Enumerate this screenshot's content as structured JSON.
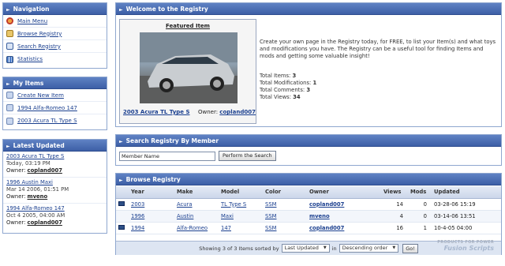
{
  "navigation": {
    "title": "Navigation",
    "items": [
      {
        "label": "Main Menu",
        "icon": "home-icon"
      },
      {
        "label": "Browse Registry",
        "icon": "browse-icon"
      },
      {
        "label": "Search Registry",
        "icon": "search-icon"
      },
      {
        "label": "Statistics",
        "icon": "statistics-icon"
      }
    ]
  },
  "my_items": {
    "title": "My Items",
    "items": [
      {
        "label": "Create New Item"
      },
      {
        "label": "1994 Alfa-Romeo 147"
      },
      {
        "label": "2003 Acura TL Type S"
      }
    ]
  },
  "latest_updated": {
    "title": "Latest Updated",
    "entries": [
      {
        "title": "2003 Acura TL Type S",
        "date": "Today, 03:19 PM",
        "owner_label": "Owner:",
        "owner": "copland007"
      },
      {
        "title": "1996 Austin Maxi",
        "date": "Mar 14 2006, 01:51 PM",
        "owner_label": "Owner:",
        "owner": "mveno"
      },
      {
        "title": "1994 Alfa-Romeo 147",
        "date": "Oct 4 2005, 04:00 AM",
        "owner_label": "Owner:",
        "owner": "copland007"
      }
    ]
  },
  "welcome": {
    "title": "Welcome to the Registry",
    "featured_title": "Featured Item",
    "featured_caption": "2003 Acura TL Type S",
    "featured_owner_label": "Owner:",
    "featured_owner": "copland007",
    "intro": "Create your own page in the Registry today, for FREE, to list your Item(s) and what toys and modifications you have. The Registry can be a useful tool for finding Items and mods and getting some valuable insight!",
    "stats": [
      {
        "label": "Total Items:",
        "value": "3"
      },
      {
        "label": "Total Modifications:",
        "value": "1"
      },
      {
        "label": "Total Comments:",
        "value": "3"
      },
      {
        "label": "Total Views:",
        "value": "34"
      }
    ]
  },
  "search": {
    "title": "Search Registry By Member",
    "input_value": "Member Name",
    "button": "Perform the Search"
  },
  "browse": {
    "title": "Browse Registry",
    "columns": [
      "Year",
      "Make",
      "Model",
      "Color",
      "Owner",
      "Views",
      "Mods",
      "Updated"
    ],
    "rows": [
      {
        "year": "2003",
        "make": "Acura",
        "model": "TL Type S",
        "color": "SSM",
        "owner": "copland007",
        "views": "14",
        "mods": "0",
        "updated": "03-28-06 15:19",
        "has_photo": true
      },
      {
        "year": "1996",
        "make": "Austin",
        "model": "Maxi",
        "color": "SSM",
        "owner": "mveno",
        "views": "4",
        "mods": "0",
        "updated": "03-14-06 13:51",
        "has_photo": false
      },
      {
        "year": "1994",
        "make": "Alfa-Romeo",
        "model": "147",
        "color": "SSM",
        "owner": "copland007",
        "views": "16",
        "mods": "1",
        "updated": "10-4-05 04:00",
        "has_photo": true
      }
    ],
    "footer": {
      "showing": "Showing 3 of 3 Items sorted by",
      "sort_value": "Last Updated",
      "in_label": "in",
      "order_value": "Descending order",
      "go": "Go!"
    }
  },
  "watermark": {
    "sub": "PRODUCTS FOR POWER",
    "brand": "Fusion Scripts"
  },
  "colors": {
    "header_blue": "#3d5fa6",
    "link": "#1a3f8f",
    "border": "#8fa7cf"
  }
}
